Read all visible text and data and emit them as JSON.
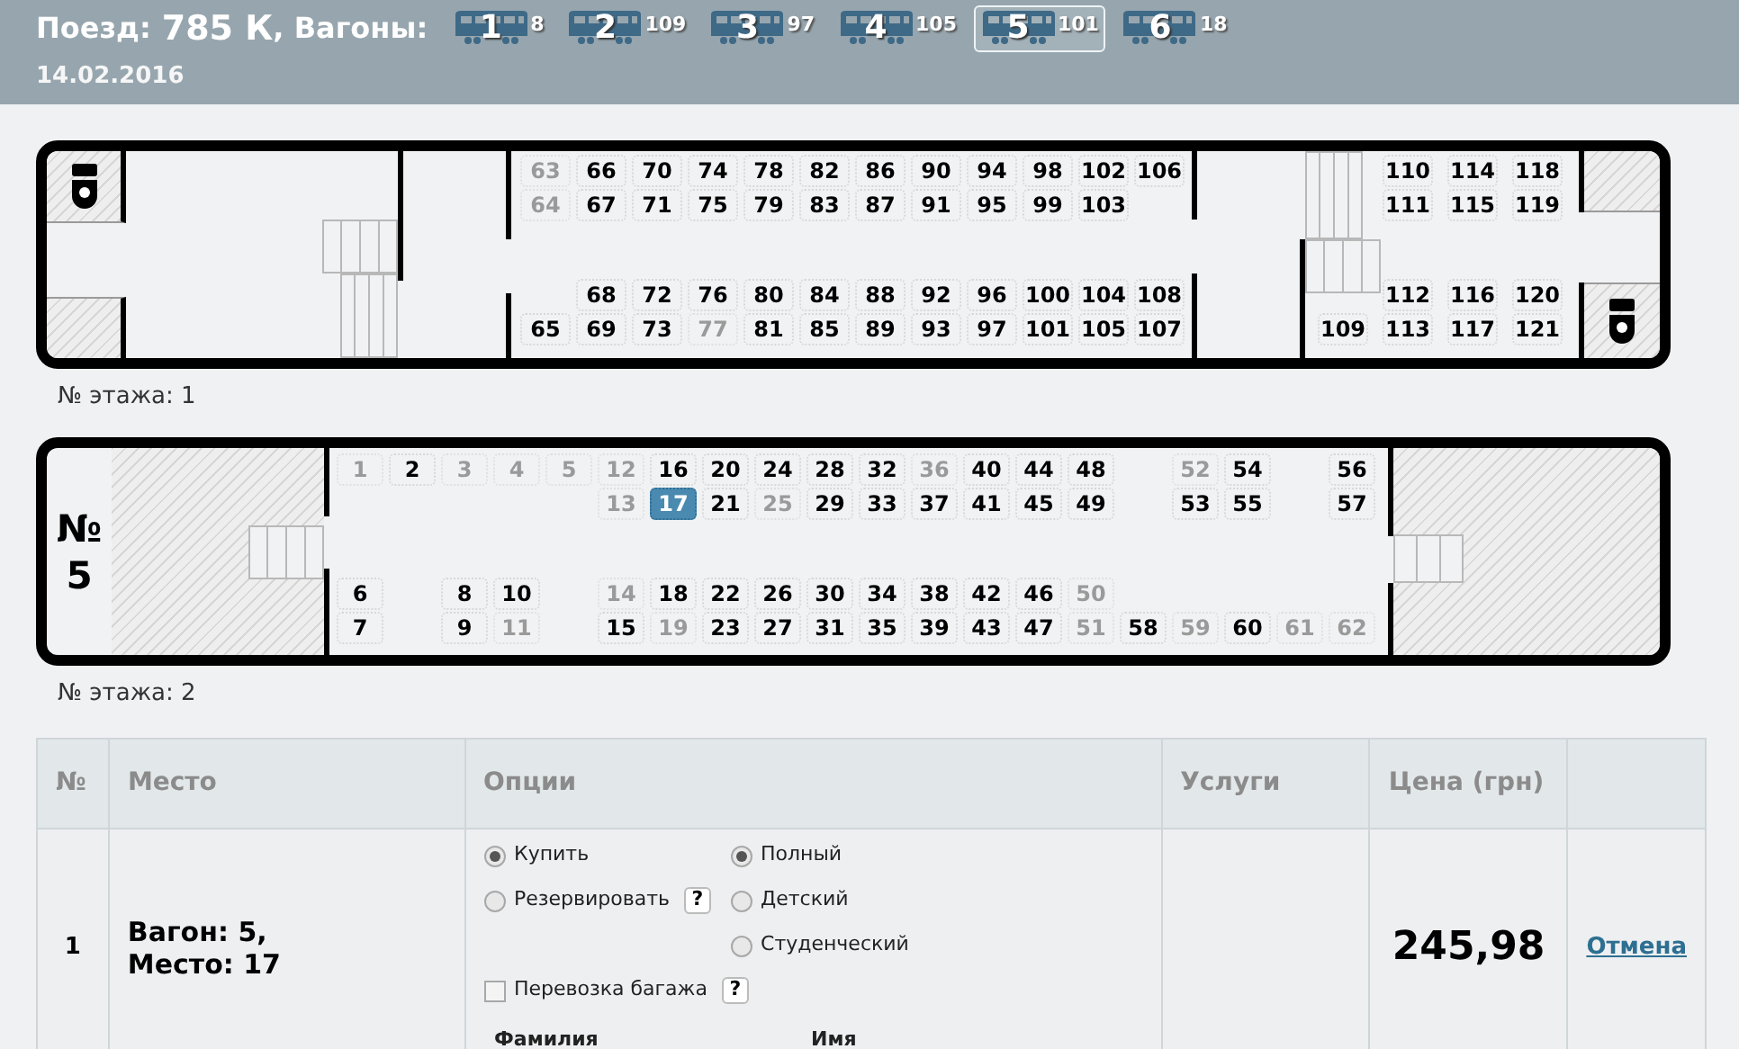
{
  "header": {
    "train_prefix": "Поезд:",
    "train": "785 К",
    "wagons_suffix": ", Вагоны:",
    "date": "14.02.2016",
    "wagons": [
      {
        "number": "1",
        "seats": "8",
        "selected": false
      },
      {
        "number": "2",
        "seats": "109",
        "selected": false
      },
      {
        "number": "3",
        "seats": "97",
        "selected": false
      },
      {
        "number": "4",
        "seats": "105",
        "selected": false
      },
      {
        "number": "5",
        "seats": "101",
        "selected": true
      },
      {
        "number": "6",
        "seats": "18",
        "selected": false
      }
    ]
  },
  "decks": [
    {
      "kind": "lower",
      "floor_label": "№ этажа: 1",
      "groups": [
        {
          "columns": [
            [
              {
                "n": "63",
                "available": false,
                "selected": false
              },
              {
                "n": "64",
                "available": false,
                "selected": false
              },
              null,
              {
                "n": "65",
                "available": true,
                "selected": false
              }
            ],
            [
              {
                "n": "66",
                "available": true,
                "selected": false
              },
              {
                "n": "67",
                "available": true,
                "selected": false
              },
              {
                "n": "68",
                "available": true,
                "selected": false
              },
              {
                "n": "69",
                "available": true,
                "selected": false
              }
            ],
            [
              {
                "n": "70",
                "available": true,
                "selected": false
              },
              {
                "n": "71",
                "available": true,
                "selected": false
              },
              {
                "n": "72",
                "available": true,
                "selected": false
              },
              {
                "n": "73",
                "available": true,
                "selected": false
              }
            ],
            [
              {
                "n": "74",
                "available": true,
                "selected": false
              },
              {
                "n": "75",
                "available": true,
                "selected": false
              },
              {
                "n": "76",
                "available": true,
                "selected": false
              },
              {
                "n": "77",
                "available": false,
                "selected": false
              }
            ],
            [
              {
                "n": "78",
                "available": true,
                "selected": false
              },
              {
                "n": "79",
                "available": true,
                "selected": false
              },
              {
                "n": "80",
                "available": true,
                "selected": false
              },
              {
                "n": "81",
                "available": true,
                "selected": false
              }
            ],
            [
              {
                "n": "82",
                "available": true,
                "selected": false
              },
              {
                "n": "83",
                "available": true,
                "selected": false
              },
              {
                "n": "84",
                "available": true,
                "selected": false
              },
              {
                "n": "85",
                "available": true,
                "selected": false
              }
            ],
            [
              {
                "n": "86",
                "available": true,
                "selected": false
              },
              {
                "n": "87",
                "available": true,
                "selected": false
              },
              {
                "n": "88",
                "available": true,
                "selected": false
              },
              {
                "n": "89",
                "available": true,
                "selected": false
              }
            ],
            [
              {
                "n": "90",
                "available": true,
                "selected": false
              },
              {
                "n": "91",
                "available": true,
                "selected": false
              },
              {
                "n": "92",
                "available": true,
                "selected": false
              },
              {
                "n": "93",
                "available": true,
                "selected": false
              }
            ],
            [
              {
                "n": "94",
                "available": true,
                "selected": false
              },
              {
                "n": "95",
                "available": true,
                "selected": false
              },
              {
                "n": "96",
                "available": true,
                "selected": false
              },
              {
                "n": "97",
                "available": true,
                "selected": false
              }
            ],
            [
              {
                "n": "98",
                "available": true,
                "selected": false
              },
              {
                "n": "99",
                "available": true,
                "selected": false
              },
              {
                "n": "100",
                "available": true,
                "selected": false
              },
              {
                "n": "101",
                "available": true,
                "selected": false
              }
            ],
            [
              {
                "n": "102",
                "available": true,
                "selected": false
              },
              {
                "n": "103",
                "available": true,
                "selected": false
              },
              {
                "n": "104",
                "available": true,
                "selected": false
              },
              {
                "n": "105",
                "available": true,
                "selected": false
              }
            ],
            [
              {
                "n": "106",
                "available": true,
                "selected": false
              },
              null,
              {
                "n": "108",
                "available": true,
                "selected": false
              },
              {
                "n": "107",
                "available": true,
                "selected": false
              }
            ]
          ]
        },
        {
          "columns": [
            [
              null,
              null,
              null,
              {
                "n": "109",
                "available": true,
                "selected": false
              }
            ],
            [
              {
                "n": "110",
                "available": true,
                "selected": false
              },
              {
                "n": "111",
                "available": true,
                "selected": false
              },
              {
                "n": "112",
                "available": true,
                "selected": false
              },
              {
                "n": "113",
                "available": true,
                "selected": false
              }
            ],
            [
              {
                "n": "114",
                "available": true,
                "selected": false
              },
              {
                "n": "115",
                "available": true,
                "selected": false
              },
              {
                "n": "116",
                "available": true,
                "selected": false
              },
              {
                "n": "117",
                "available": true,
                "selected": false
              }
            ],
            [
              {
                "n": "118",
                "available": true,
                "selected": false
              },
              {
                "n": "119",
                "available": true,
                "selected": false
              },
              {
                "n": "120",
                "available": true,
                "selected": false
              },
              {
                "n": "121",
                "available": true,
                "selected": false
              }
            ]
          ]
        }
      ]
    },
    {
      "kind": "upper",
      "car_label": "№ 5",
      "floor_label": "№ этажа: 2",
      "groups": [
        {
          "columns": [
            [
              {
                "n": "1",
                "available": false,
                "selected": false
              },
              null,
              {
                "n": "6",
                "available": true,
                "selected": false
              },
              {
                "n": "7",
                "available": true,
                "selected": false
              }
            ],
            [
              {
                "n": "2",
                "available": true,
                "selected": false
              },
              null,
              null,
              null
            ],
            [
              {
                "n": "3",
                "available": false,
                "selected": false
              },
              null,
              {
                "n": "8",
                "available": true,
                "selected": false
              },
              {
                "n": "9",
                "available": true,
                "selected": false
              }
            ],
            [
              {
                "n": "4",
                "available": false,
                "selected": false
              },
              null,
              {
                "n": "10",
                "available": true,
                "selected": false
              },
              {
                "n": "11",
                "available": false,
                "selected": false
              }
            ],
            [
              {
                "n": "5",
                "available": false,
                "selected": false
              },
              null,
              null,
              null
            ],
            [
              {
                "n": "12",
                "available": false,
                "selected": false
              },
              {
                "n": "13",
                "available": false,
                "selected": false
              },
              {
                "n": "14",
                "available": false,
                "selected": false
              },
              {
                "n": "15",
                "available": true,
                "selected": false
              }
            ],
            [
              {
                "n": "16",
                "available": true,
                "selected": false
              },
              {
                "n": "17",
                "available": true,
                "selected": true
              },
              {
                "n": "18",
                "available": true,
                "selected": false
              },
              {
                "n": "19",
                "available": false,
                "selected": false
              }
            ],
            [
              {
                "n": "20",
                "available": true,
                "selected": false
              },
              {
                "n": "21",
                "available": true,
                "selected": false
              },
              {
                "n": "22",
                "available": true,
                "selected": false
              },
              {
                "n": "23",
                "available": true,
                "selected": false
              }
            ],
            [
              {
                "n": "24",
                "available": true,
                "selected": false
              },
              {
                "n": "25",
                "available": false,
                "selected": false
              },
              {
                "n": "26",
                "available": true,
                "selected": false
              },
              {
                "n": "27",
                "available": true,
                "selected": false
              }
            ],
            [
              {
                "n": "28",
                "available": true,
                "selected": false
              },
              {
                "n": "29",
                "available": true,
                "selected": false
              },
              {
                "n": "30",
                "available": true,
                "selected": false
              },
              {
                "n": "31",
                "available": true,
                "selected": false
              }
            ],
            [
              {
                "n": "32",
                "available": true,
                "selected": false
              },
              {
                "n": "33",
                "available": true,
                "selected": false
              },
              {
                "n": "34",
                "available": true,
                "selected": false
              },
              {
                "n": "35",
                "available": true,
                "selected": false
              }
            ],
            [
              {
                "n": "36",
                "available": false,
                "selected": false
              },
              {
                "n": "37",
                "available": true,
                "selected": false
              },
              {
                "n": "38",
                "available": true,
                "selected": false
              },
              {
                "n": "39",
                "available": true,
                "selected": false
              }
            ],
            [
              {
                "n": "40",
                "available": true,
                "selected": false
              },
              {
                "n": "41",
                "available": true,
                "selected": false
              },
              {
                "n": "42",
                "available": true,
                "selected": false
              },
              {
                "n": "43",
                "available": true,
                "selected": false
              }
            ],
            [
              {
                "n": "44",
                "available": true,
                "selected": false
              },
              {
                "n": "45",
                "available": true,
                "selected": false
              },
              {
                "n": "46",
                "available": true,
                "selected": false
              },
              {
                "n": "47",
                "available": true,
                "selected": false
              }
            ],
            [
              {
                "n": "48",
                "available": true,
                "selected": false
              },
              {
                "n": "49",
                "available": true,
                "selected": false
              },
              {
                "n": "50",
                "available": false,
                "selected": false
              },
              {
                "n": "51",
                "available": false,
                "selected": false
              }
            ],
            [
              null,
              null,
              null,
              {
                "n": "58",
                "available": true,
                "selected": false
              }
            ],
            [
              {
                "n": "52",
                "available": false,
                "selected": false
              },
              {
                "n": "53",
                "available": true,
                "selected": false
              },
              null,
              {
                "n": "59",
                "available": false,
                "selected": false
              }
            ],
            [
              {
                "n": "54",
                "available": true,
                "selected": false
              },
              {
                "n": "55",
                "available": true,
                "selected": false
              },
              null,
              {
                "n": "60",
                "available": true,
                "selected": false
              }
            ],
            [
              null,
              null,
              null,
              {
                "n": "61",
                "available": false,
                "selected": false
              }
            ],
            [
              {
                "n": "56",
                "available": true,
                "selected": false
              },
              {
                "n": "57",
                "available": true,
                "selected": false
              },
              null,
              {
                "n": "62",
                "available": false,
                "selected": false
              }
            ]
          ]
        }
      ]
    }
  ],
  "table": {
    "columns": [
      "№",
      "Место",
      "Опции",
      "Услуги",
      "Цена (грн)"
    ],
    "rows": [
      {
        "number": "1",
        "place": [
          "Вагон: 5,",
          "Место: 17"
        ],
        "ticket_type": [
          {
            "label": "Купить",
            "selected": true
          },
          {
            "label": "Резервировать",
            "selected": false,
            "help": "?"
          }
        ],
        "fare": [
          {
            "label": "Полный",
            "selected": true
          },
          {
            "label": "Детский",
            "selected": false
          },
          {
            "label": "Студенческий",
            "selected": false
          }
        ],
        "baggage": {
          "label": "Перевозка багажа",
          "checked": false,
          "help": "?"
        },
        "fields": [
          "Фамилия",
          "Имя"
        ],
        "price": "245,98",
        "action": "Отмена"
      }
    ]
  }
}
